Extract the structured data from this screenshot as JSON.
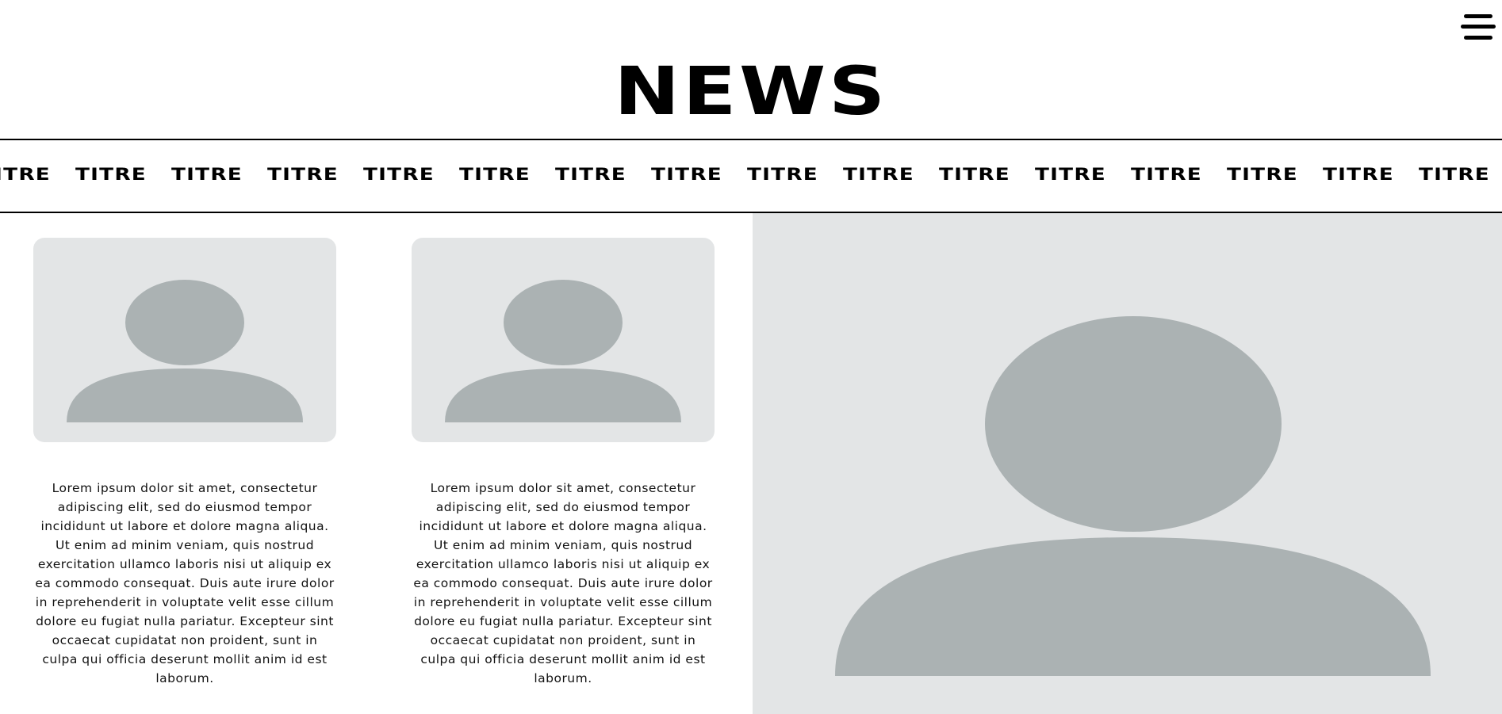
{
  "header": {
    "title": "NEWS",
    "menu_icon": "hamburger-menu-icon"
  },
  "ticker": {
    "items": [
      "TITRE",
      "TITRE",
      "TITRE",
      "TITRE",
      "TITRE",
      "TITRE",
      "TITRE",
      "TITRE",
      "TITRE",
      "TITRE",
      "TITRE",
      "TITRE",
      "TITRE",
      "TITRE",
      "TITRE",
      "TITRE"
    ]
  },
  "articles": [
    {
      "image_icon": "user-placeholder-icon",
      "text": "Lorem ipsum dolor sit amet, consectetur adipiscing elit, sed do eiusmod tempor incididunt ut labore et dolore magna aliqua. Ut enim ad minim veniam, quis nostrud exercitation ullamco laboris nisi ut aliquip ex ea commodo consequat. Duis aute irure dolor in reprehenderit in voluptate velit esse cillum dolore eu fugiat nulla pariatur. Excepteur sint occaecat cupidatat non proident, sunt in culpa qui officia deserunt mollit anim id est laborum."
    },
    {
      "image_icon": "user-placeholder-icon",
      "text": "Lorem ipsum dolor sit amet, consectetur adipiscing elit, sed do eiusmod tempor incididunt ut labore et dolore magna aliqua. Ut enim ad minim veniam, quis nostrud exercitation ullamco laboris nisi ut aliquip ex ea commodo consequat. Duis aute irure dolor in reprehenderit in voluptate velit esse cillum dolore eu fugiat nulla pariatur. Excepteur sint occaecat cupidatat non proident, sunt in culpa qui officia deserunt mollit anim id est laborum."
    }
  ],
  "hero": {
    "image_icon": "user-placeholder-icon"
  },
  "colors": {
    "placeholder_bg": "#e3e5e6",
    "placeholder_fg": "#abb2b3",
    "text": "#000000"
  }
}
